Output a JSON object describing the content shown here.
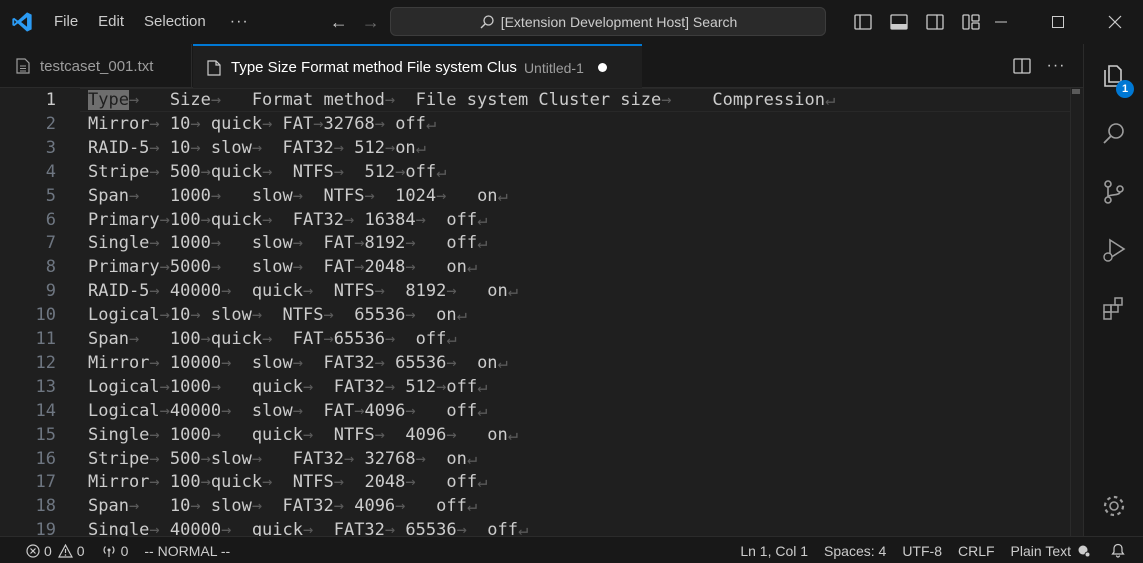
{
  "titlebar": {
    "menu": [
      "File",
      "Edit",
      "Selection",
      "···"
    ],
    "search_text": "[Extension Development Host] Search"
  },
  "tabs": [
    {
      "label": "testcaset_001.txt",
      "description": "",
      "active": false
    },
    {
      "label": "Type Size Format method File system Clus",
      "description": "Untitled-1",
      "active": true,
      "dirty": true
    }
  ],
  "activity_badge": "1",
  "editor": {
    "current_line": 1,
    "lines": [
      [
        {
          "t": "Type",
          "cur": true
        },
        {
          "w": "→"
        },
        {
          "t": "   Size"
        },
        {
          "w": "→"
        },
        {
          "t": "   Format method"
        },
        {
          "w": "→"
        },
        {
          "t": "  File system Cluster size"
        },
        {
          "w": "→"
        },
        {
          "t": "    Compression"
        },
        {
          "w": "↵"
        }
      ],
      [
        {
          "t": "Mirror"
        },
        {
          "w": "→"
        },
        {
          "t": " 10"
        },
        {
          "w": "→"
        },
        {
          "t": " quick"
        },
        {
          "w": "→"
        },
        {
          "t": " FAT"
        },
        {
          "w": "→"
        },
        {
          "t": "32768"
        },
        {
          "w": "→"
        },
        {
          "t": " off"
        },
        {
          "w": "↵"
        }
      ],
      [
        {
          "t": "RAID-5"
        },
        {
          "w": "→"
        },
        {
          "t": " 10"
        },
        {
          "w": "→"
        },
        {
          "t": " slow"
        },
        {
          "w": "→"
        },
        {
          "t": "  FAT32"
        },
        {
          "w": "→"
        },
        {
          "t": " 512"
        },
        {
          "w": "→"
        },
        {
          "t": "on"
        },
        {
          "w": "↵"
        }
      ],
      [
        {
          "t": "Stripe"
        },
        {
          "w": "→"
        },
        {
          "t": " 500"
        },
        {
          "w": "→"
        },
        {
          "t": "quick"
        },
        {
          "w": "→"
        },
        {
          "t": "  NTFS"
        },
        {
          "w": "→"
        },
        {
          "t": "  512"
        },
        {
          "w": "→"
        },
        {
          "t": "off"
        },
        {
          "w": "↵"
        }
      ],
      [
        {
          "t": "Span"
        },
        {
          "w": "→"
        },
        {
          "t": "   1000"
        },
        {
          "w": "→"
        },
        {
          "t": "   slow"
        },
        {
          "w": "→"
        },
        {
          "t": "  NTFS"
        },
        {
          "w": "→"
        },
        {
          "t": "  1024"
        },
        {
          "w": "→"
        },
        {
          "t": "   on"
        },
        {
          "w": "↵"
        }
      ],
      [
        {
          "t": "Primary"
        },
        {
          "w": "→"
        },
        {
          "t": "100"
        },
        {
          "w": "→"
        },
        {
          "t": "quick"
        },
        {
          "w": "→"
        },
        {
          "t": "  FAT32"
        },
        {
          "w": "→"
        },
        {
          "t": " 16384"
        },
        {
          "w": "→"
        },
        {
          "t": "  off"
        },
        {
          "w": "↵"
        }
      ],
      [
        {
          "t": "Single"
        },
        {
          "w": "→"
        },
        {
          "t": " 1000"
        },
        {
          "w": "→"
        },
        {
          "t": "   slow"
        },
        {
          "w": "→"
        },
        {
          "t": "  FAT"
        },
        {
          "w": "→"
        },
        {
          "t": "8192"
        },
        {
          "w": "→"
        },
        {
          "t": "   off"
        },
        {
          "w": "↵"
        }
      ],
      [
        {
          "t": "Primary"
        },
        {
          "w": "→"
        },
        {
          "t": "5000"
        },
        {
          "w": "→"
        },
        {
          "t": "   slow"
        },
        {
          "w": "→"
        },
        {
          "t": "  FAT"
        },
        {
          "w": "→"
        },
        {
          "t": "2048"
        },
        {
          "w": "→"
        },
        {
          "t": "   on"
        },
        {
          "w": "↵"
        }
      ],
      [
        {
          "t": "RAID-5"
        },
        {
          "w": "→"
        },
        {
          "t": " 40000"
        },
        {
          "w": "→"
        },
        {
          "t": "  quick"
        },
        {
          "w": "→"
        },
        {
          "t": "  NTFS"
        },
        {
          "w": "→"
        },
        {
          "t": "  8192"
        },
        {
          "w": "→"
        },
        {
          "t": "   on"
        },
        {
          "w": "↵"
        }
      ],
      [
        {
          "t": "Logical"
        },
        {
          "w": "→"
        },
        {
          "t": "10"
        },
        {
          "w": "→"
        },
        {
          "t": " slow"
        },
        {
          "w": "→"
        },
        {
          "t": "  NTFS"
        },
        {
          "w": "→"
        },
        {
          "t": "  65536"
        },
        {
          "w": "→"
        },
        {
          "t": "  on"
        },
        {
          "w": "↵"
        }
      ],
      [
        {
          "t": "Span"
        },
        {
          "w": "→"
        },
        {
          "t": "   100"
        },
        {
          "w": "→"
        },
        {
          "t": "quick"
        },
        {
          "w": "→"
        },
        {
          "t": "  FAT"
        },
        {
          "w": "→"
        },
        {
          "t": "65536"
        },
        {
          "w": "→"
        },
        {
          "t": "  off"
        },
        {
          "w": "↵"
        }
      ],
      [
        {
          "t": "Mirror"
        },
        {
          "w": "→"
        },
        {
          "t": " 10000"
        },
        {
          "w": "→"
        },
        {
          "t": "  slow"
        },
        {
          "w": "→"
        },
        {
          "t": "  FAT32"
        },
        {
          "w": "→"
        },
        {
          "t": " 65536"
        },
        {
          "w": "→"
        },
        {
          "t": "  on"
        },
        {
          "w": "↵"
        }
      ],
      [
        {
          "t": "Logical"
        },
        {
          "w": "→"
        },
        {
          "t": "1000"
        },
        {
          "w": "→"
        },
        {
          "t": "   quick"
        },
        {
          "w": "→"
        },
        {
          "t": "  FAT32"
        },
        {
          "w": "→"
        },
        {
          "t": " 512"
        },
        {
          "w": "→"
        },
        {
          "t": "off"
        },
        {
          "w": "↵"
        }
      ],
      [
        {
          "t": "Logical"
        },
        {
          "w": "→"
        },
        {
          "t": "40000"
        },
        {
          "w": "→"
        },
        {
          "t": "  slow"
        },
        {
          "w": "→"
        },
        {
          "t": "  FAT"
        },
        {
          "w": "→"
        },
        {
          "t": "4096"
        },
        {
          "w": "→"
        },
        {
          "t": "   off"
        },
        {
          "w": "↵"
        }
      ],
      [
        {
          "t": "Single"
        },
        {
          "w": "→"
        },
        {
          "t": " 1000"
        },
        {
          "w": "→"
        },
        {
          "t": "   quick"
        },
        {
          "w": "→"
        },
        {
          "t": "  NTFS"
        },
        {
          "w": "→"
        },
        {
          "t": "  4096"
        },
        {
          "w": "→"
        },
        {
          "t": "   on"
        },
        {
          "w": "↵"
        }
      ],
      [
        {
          "t": "Stripe"
        },
        {
          "w": "→"
        },
        {
          "t": " 500"
        },
        {
          "w": "→"
        },
        {
          "t": "slow"
        },
        {
          "w": "→"
        },
        {
          "t": "   FAT32"
        },
        {
          "w": "→"
        },
        {
          "t": " 32768"
        },
        {
          "w": "→"
        },
        {
          "t": "  on"
        },
        {
          "w": "↵"
        }
      ],
      [
        {
          "t": "Mirror"
        },
        {
          "w": "→"
        },
        {
          "t": " 100"
        },
        {
          "w": "→"
        },
        {
          "t": "quick"
        },
        {
          "w": "→"
        },
        {
          "t": "  NTFS"
        },
        {
          "w": "→"
        },
        {
          "t": "  2048"
        },
        {
          "w": "→"
        },
        {
          "t": "   off"
        },
        {
          "w": "↵"
        }
      ],
      [
        {
          "t": "Span"
        },
        {
          "w": "→"
        },
        {
          "t": "   10"
        },
        {
          "w": "→"
        },
        {
          "t": " slow"
        },
        {
          "w": "→"
        },
        {
          "t": "  FAT32"
        },
        {
          "w": "→"
        },
        {
          "t": " 4096"
        },
        {
          "w": "→"
        },
        {
          "t": "   off"
        },
        {
          "w": "↵"
        }
      ],
      [
        {
          "t": "Single"
        },
        {
          "w": "→"
        },
        {
          "t": " 40000"
        },
        {
          "w": "→"
        },
        {
          "t": "  quick"
        },
        {
          "w": "→"
        },
        {
          "t": "  FAT32"
        },
        {
          "w": "→"
        },
        {
          "t": " 65536"
        },
        {
          "w": "→"
        },
        {
          "t": "  off"
        },
        {
          "w": "↵"
        }
      ]
    ]
  },
  "statusbar": {
    "errors": "0",
    "warnings": "0",
    "ports": "0",
    "mode": "-- NORMAL --",
    "position": "Ln 1, Col 1",
    "spaces": "Spaces: 4",
    "encoding": "UTF-8",
    "eol": "CRLF",
    "language": "Plain Text"
  },
  "colors": {
    "accent": "#0078d4",
    "background": "#1f1f1f",
    "chrome": "#181818"
  }
}
